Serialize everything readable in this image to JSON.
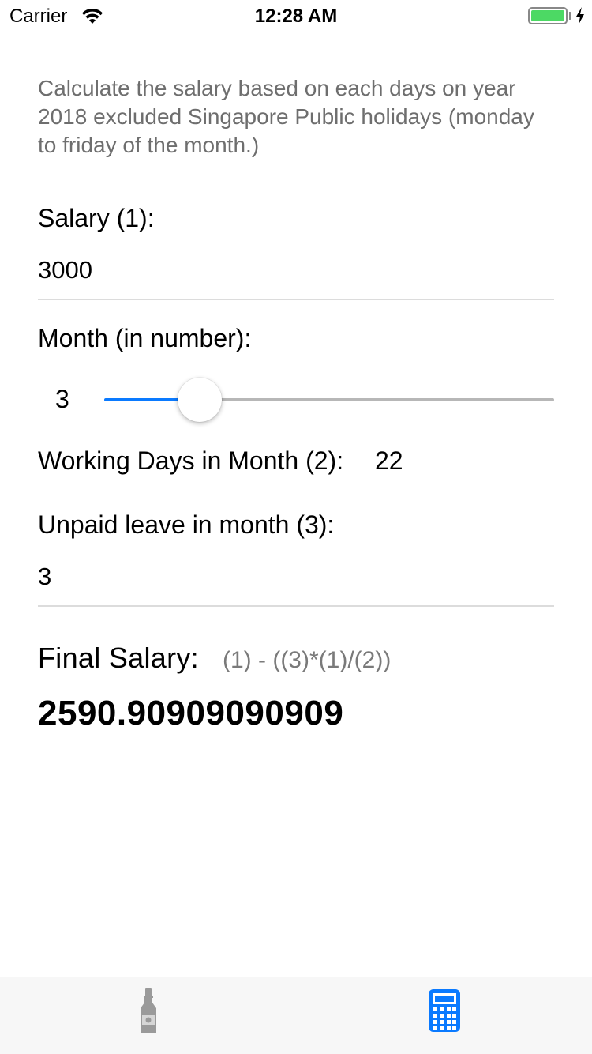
{
  "status_bar": {
    "carrier": "Carrier",
    "time": "12:28 AM"
  },
  "description": "Calculate the salary based on each days on year 2018 excluded Singapore Public holidays (monday to friday of the month.)",
  "salary": {
    "label": "Salary (1):",
    "value": "3000"
  },
  "month": {
    "label": "Month (in number):",
    "value": "3",
    "slider_min": 1,
    "slider_max": 12,
    "slider_value": 3
  },
  "working_days": {
    "label": "Working Days in Month (2):",
    "value": "22"
  },
  "unpaid_leave": {
    "label": "Unpaid leave in month (3):",
    "value": "3"
  },
  "final": {
    "label": "Final Salary:",
    "formula": "(1) - ((3)*(1)/(2))",
    "value": "2590.90909090909"
  },
  "tab_bar": {
    "items": [
      {
        "icon": "bottle-icon",
        "selected": false
      },
      {
        "icon": "calculator-icon",
        "selected": true
      }
    ]
  },
  "colors": {
    "accent": "#0a7aff",
    "battery": "#4cd964",
    "secondary_text": "#6e6e6e"
  }
}
